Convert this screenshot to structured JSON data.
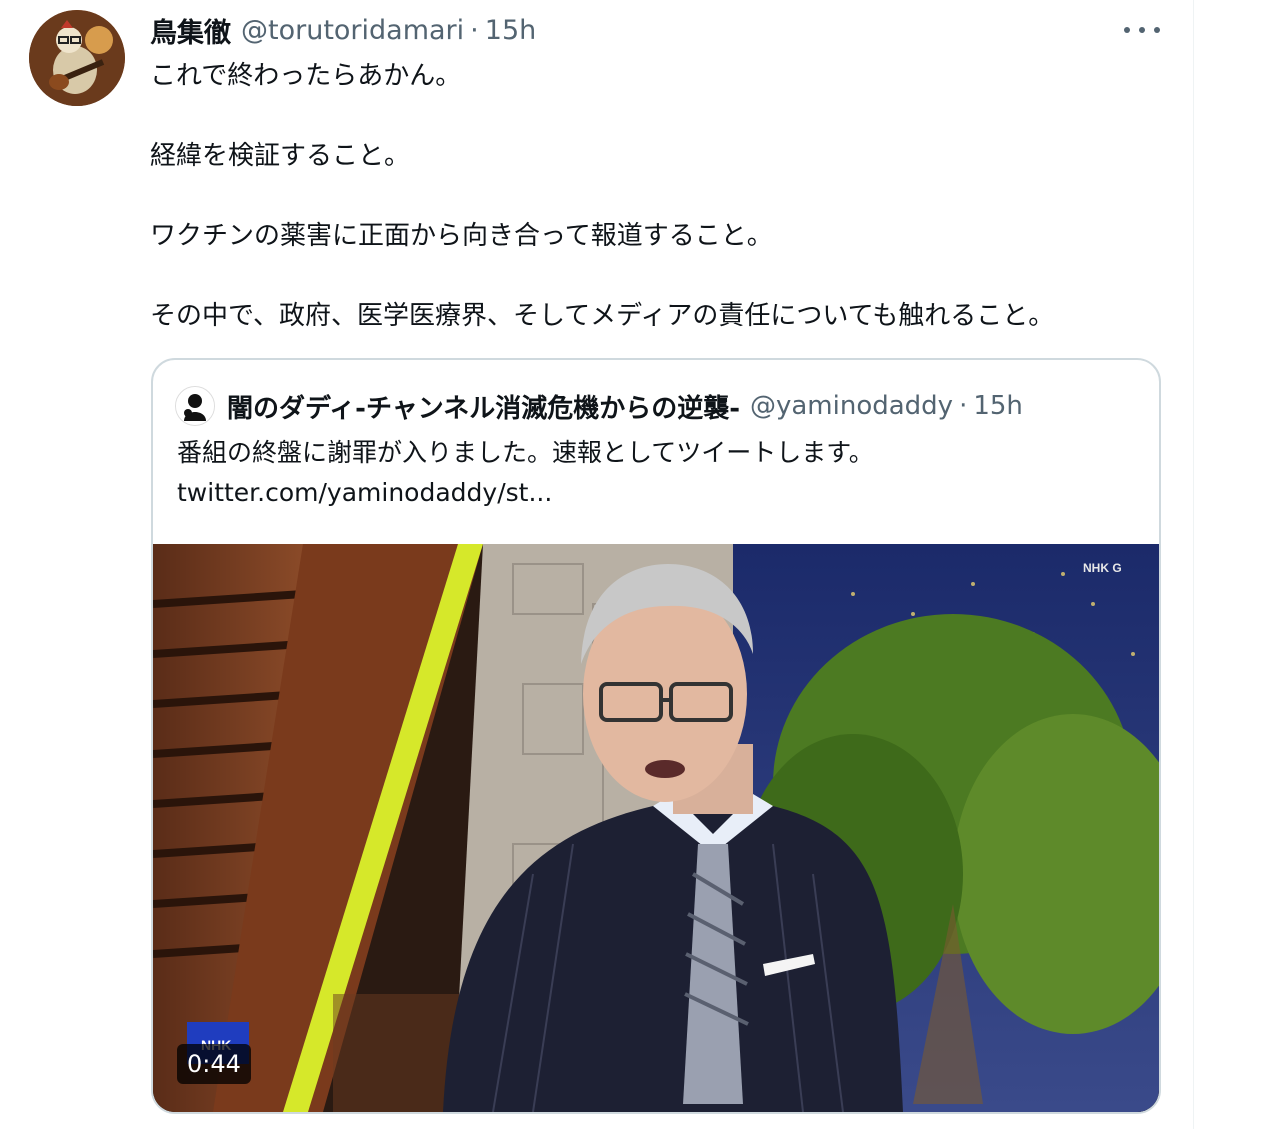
{
  "tweet": {
    "display_name": "鳥集徹",
    "handle": "@torutoridamari",
    "separator": "·",
    "time": "15h",
    "paragraphs": [
      "これで終わったらあかん。",
      "経緯を検証すること。",
      "ワクチンの薬害に正面から向き合って報道すること。",
      "その中で、政府、医学医療界、そしてメディアの責任についても触れること。"
    ]
  },
  "quoted": {
    "display_name": "闇のダディ-チャンネル消滅危機からの逆襲-",
    "handle": "@yaminodaddy",
    "separator": "·",
    "time": "15h",
    "text": "番組の終盤に謝罪が入りました。速報としてツイートします。",
    "link": "twitter.com/yaminodaddy/st...",
    "video": {
      "duration": "0:44",
      "channel_logo": "NHK G",
      "corner_logo": "NHK"
    }
  },
  "icons": {
    "more": "more-dots-icon"
  }
}
